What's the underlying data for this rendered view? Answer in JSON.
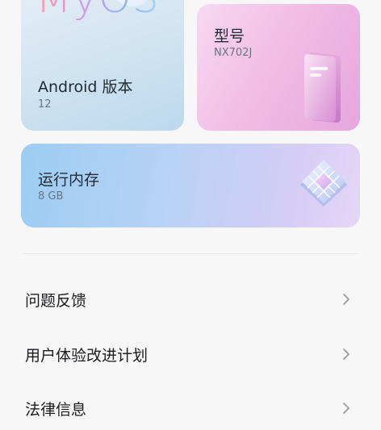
{
  "os_card": {
    "logo_text": "MyOS",
    "title": "Android 版本",
    "value": "12"
  },
  "model_card": {
    "title": "型号",
    "value": "NX702J"
  },
  "ram_card": {
    "title": "运行内存",
    "value": "8 GB"
  },
  "menu": [
    {
      "label": "问题反馈"
    },
    {
      "label": "用户体验改进计划"
    },
    {
      "label": "法律信息"
    }
  ],
  "icons": {
    "phone": "phone-3d-icon",
    "chip": "memory-chip-icon",
    "chevron": "chevron-right-icon"
  }
}
